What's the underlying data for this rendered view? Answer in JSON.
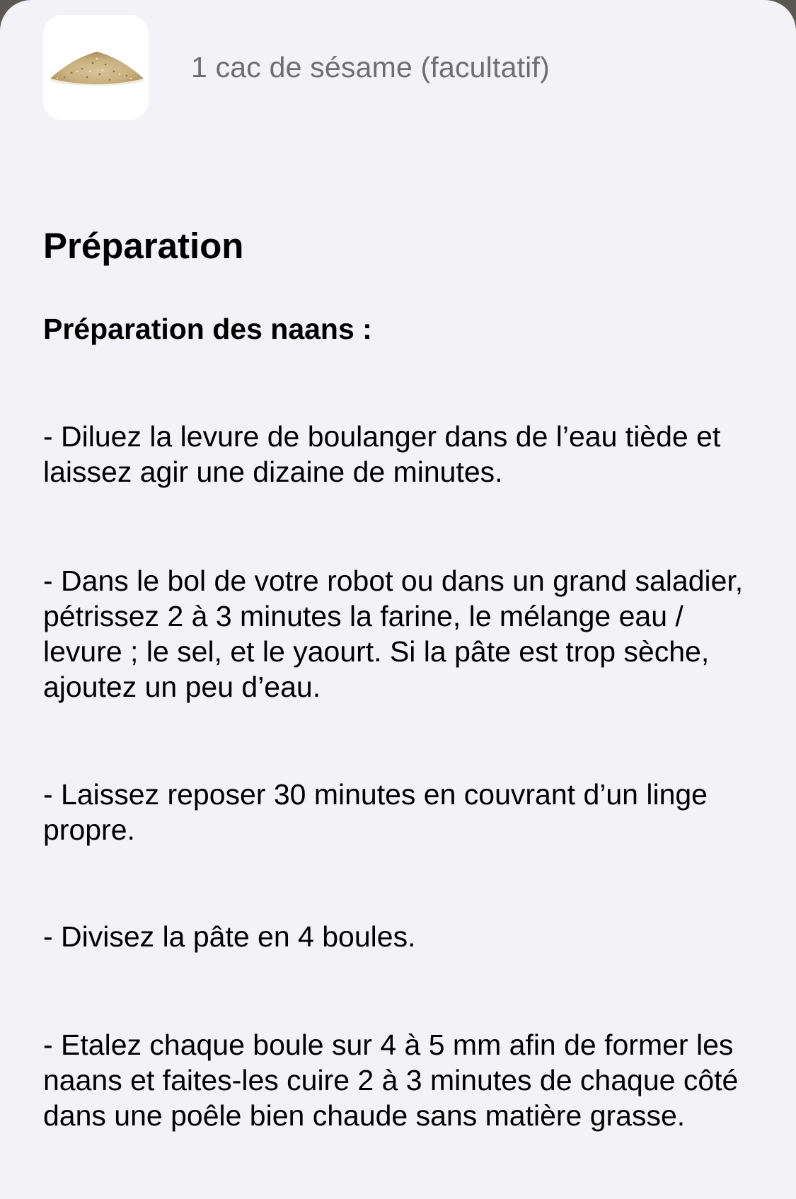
{
  "ingredient": {
    "image_icon": "sesame-seeds-image",
    "text": "1 cac de sésame (facultatif)"
  },
  "section_title": "Préparation",
  "subheading": "Préparation des naans :",
  "steps": [
    "- Diluez la levure de boulanger dans de l’eau tiède et laissez agir une dizaine de minutes.",
    "- Dans le bol de votre robot ou dans un grand saladier, pétrissez 2 à 3 minutes la farine, le mélange eau / levure ; le sel, et le yaourt. Si la pâte est trop sèche, ajoutez un peu d’eau.",
    "- Laissez reposer 30 minutes en couvrant d’un linge propre.",
    "- Divisez la pâte en 4 boules.",
    "- Etalez chaque boule sur 4 à 5 mm afin de former les naans et faites-les cuire 2 à 3 minutes de chaque côté dans une poêle bien chaude sans matière grasse."
  ]
}
